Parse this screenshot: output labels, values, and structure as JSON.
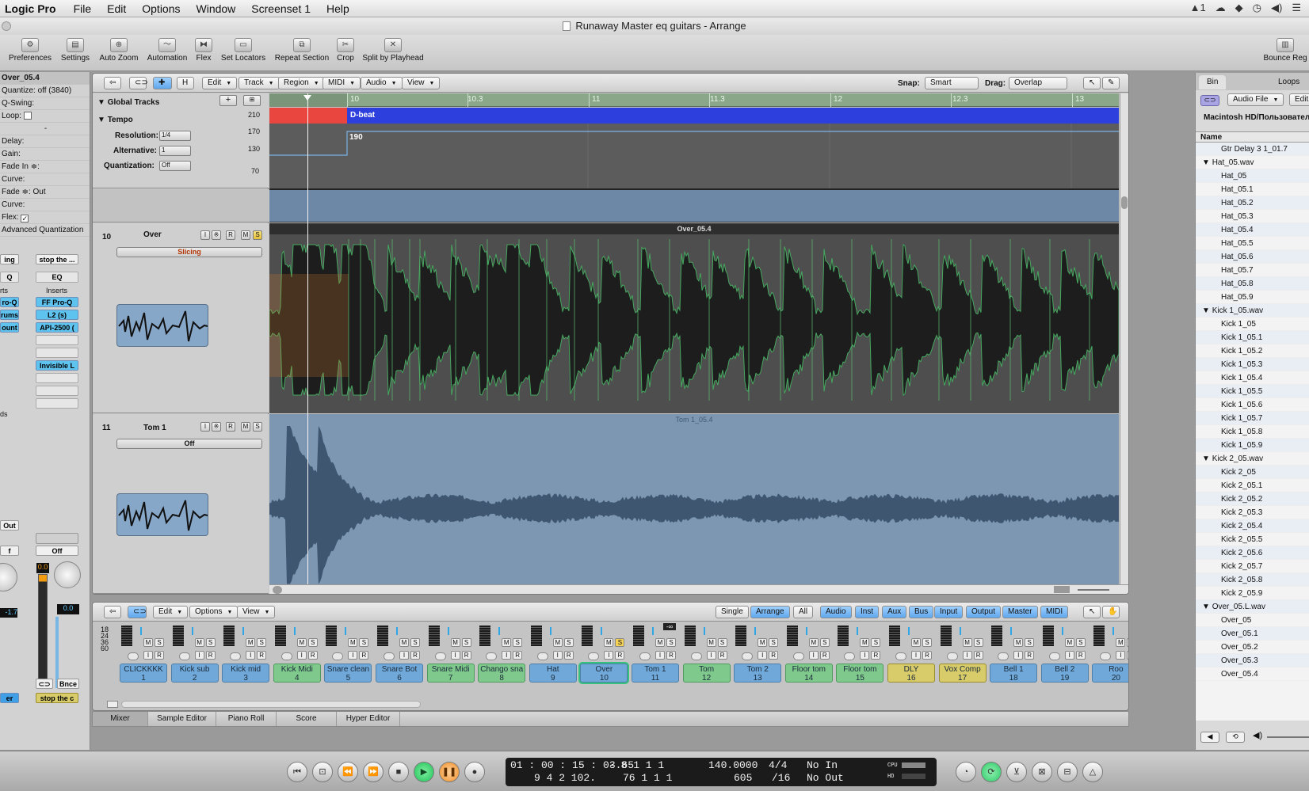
{
  "menubar": {
    "app": "Logic Pro",
    "items": [
      "File",
      "Edit",
      "Options",
      "Window",
      "Screenset 1",
      "Help"
    ],
    "status_text": "1"
  },
  "window": {
    "title": "Runaway Master eq guitars - Arrange"
  },
  "toolbar": {
    "items": [
      {
        "label": "Preferences",
        "icon": "preferences-icon"
      },
      {
        "label": "Settings",
        "icon": "settings-icon"
      },
      {
        "label": "Auto Zoom",
        "icon": "zoom-icon"
      },
      {
        "label": "Automation",
        "icon": "automation-icon"
      },
      {
        "label": "Flex",
        "icon": "flex-icon"
      },
      {
        "label": "Set Locators",
        "icon": "locators-icon"
      },
      {
        "label": "Repeat Section",
        "icon": "repeat-icon"
      },
      {
        "label": "Crop",
        "icon": "crop-icon"
      },
      {
        "label": "Split by Playhead",
        "icon": "split-icon"
      }
    ],
    "right_label": "Bounce Reg"
  },
  "inspector": {
    "region_name": "Over_05.4",
    "quantize": "Quantize: off (3840)",
    "swing": "Q-Swing:",
    "loop": "Loop:",
    "dash": "-",
    "delay": "Delay:",
    "gain": "Gain:",
    "fade_in": "Fade In ≑:",
    "curve1": "Curve:",
    "fade_out": "Fade ≑: Out",
    "curve2": "Curve:",
    "flex": "Flex:",
    "adv_quant": "Advanced Quantization",
    "strip_a": {
      "label": "ing",
      "eq": "Q",
      "inserts": "rts",
      "plugins": [
        "ro-Q",
        "rums",
        "ount"
      ],
      "sends": "ds",
      "out": "Out",
      "auto": "f",
      "vol": "-1.7",
      "name": "er"
    },
    "strip_b": {
      "label": "stop the ...",
      "eq": "EQ",
      "inserts": "Inserts",
      "plugins": [
        "FF Pro-Q",
        "L2 (s)",
        "API-2500 ("
      ],
      "invisible": "Invisible L",
      "auto": "Off",
      "vol": "0.0",
      "peak": "0.0",
      "bounce": "Bnce",
      "name": "stop the c"
    }
  },
  "arrange_bar": {
    "edit": "Edit",
    "track": "Track",
    "region": "Region",
    "midi": "MIDI",
    "audio": "Audio",
    "view": "View",
    "snap_label": "Snap:",
    "snap_value": "Smart",
    "drag_label": "Drag:",
    "drag_value": "Overlap"
  },
  "global_tracks": {
    "title": "Global Tracks",
    "tempo": "Tempo",
    "resolution_label": "Resolution:",
    "resolution_value": "1/4",
    "alternative_label": "Alternative:",
    "alternative_value": "1",
    "quantization_label": "Quantization:",
    "quantization_value": "Off",
    "scale": [
      "210",
      "170",
      "130",
      "70"
    ],
    "arrangement_marker": "D-beat",
    "tempo_value": "190"
  },
  "ruler": {
    "ticks": [
      "10",
      "10.3",
      "11",
      "11.3",
      "12",
      "12.3",
      "13"
    ]
  },
  "tracks": [
    {
      "number": "10",
      "name": "Over",
      "mode": "Slicing",
      "region": "Over_05.4"
    },
    {
      "number": "11",
      "name": "Tom 1",
      "mode": "Off",
      "region": "Tom 1_05.4"
    }
  ],
  "mixer": {
    "edit": "Edit",
    "options": "Options",
    "view": "View",
    "views": [
      "Single",
      "Arrange",
      "All"
    ],
    "filters": [
      "Audio",
      "Inst",
      "Aux",
      "Bus",
      "Input",
      "Output",
      "Master",
      "MIDI"
    ],
    "scale": [
      "18",
      "24",
      "36",
      "60"
    ],
    "strips": [
      {
        "name": "CLICKKKK",
        "num": "1",
        "color": "blue"
      },
      {
        "name": "Kick sub",
        "num": "2",
        "color": "blue"
      },
      {
        "name": "Kick mid",
        "num": "3",
        "color": "blue"
      },
      {
        "name": "Kick Midi",
        "num": "4",
        "color": "green"
      },
      {
        "name": "Snare clean",
        "num": "5",
        "color": "blue"
      },
      {
        "name": "Snare Bot",
        "num": "6",
        "color": "blue"
      },
      {
        "name": "Snare Midi",
        "num": "7",
        "color": "green"
      },
      {
        "name": "Chango sna",
        "num": "8",
        "color": "green"
      },
      {
        "name": "Hat",
        "num": "9",
        "color": "blue"
      },
      {
        "name": "Over",
        "num": "10",
        "color": "blue",
        "selected": true
      },
      {
        "name": "Tom 1",
        "num": "11",
        "color": "blue"
      },
      {
        "name": "Tom",
        "num": "12",
        "color": "green"
      },
      {
        "name": "Tom 2",
        "num": "13",
        "color": "blue"
      },
      {
        "name": "Floor tom",
        "num": "14",
        "color": "green"
      },
      {
        "name": "Floor tom",
        "num": "15",
        "color": "green"
      },
      {
        "name": "DLY",
        "num": "16",
        "color": "yellow"
      },
      {
        "name": "Vox Comp",
        "num": "17",
        "color": "yellow"
      },
      {
        "name": "Bell 1",
        "num": "18",
        "color": "blue"
      },
      {
        "name": "Bell 2",
        "num": "19",
        "color": "blue"
      },
      {
        "name": "Roo",
        "num": "20",
        "color": "blue"
      }
    ],
    "meter_readout": "-∞"
  },
  "bottom_tabs": [
    "Mixer",
    "Sample Editor",
    "Piano Roll",
    "Score",
    "Hyper Editor"
  ],
  "transport": {
    "smpte": "01 : 00 : 15 : 03.65",
    "bars": "9   4   2  102.",
    "pos_top": "-    8    1    1     1",
    "pos_bot": "76    1    1     1",
    "tempo": "140.0000",
    "tempo_sub": "605",
    "sig": "4/4",
    "div": "/16",
    "in": "No In",
    "out": "No Out",
    "cpu": "CPU",
    "hd": "HD"
  },
  "browser": {
    "tabs": [
      "Bin",
      "Loops"
    ],
    "audio_file": "Audio File",
    "edit": "Edit",
    "path": "Macintosh HD/Пользовател",
    "column": "Name",
    "items": [
      {
        "t": "child",
        "name": "Gtr Delay 3 1_01.7"
      },
      {
        "t": "head",
        "name": "Hat_05.wav"
      },
      {
        "t": "child",
        "name": "Hat_05"
      },
      {
        "t": "child",
        "name": "Hat_05.1"
      },
      {
        "t": "child",
        "name": "Hat_05.2"
      },
      {
        "t": "child",
        "name": "Hat_05.3"
      },
      {
        "t": "child",
        "name": "Hat_05.4"
      },
      {
        "t": "child",
        "name": "Hat_05.5"
      },
      {
        "t": "child",
        "name": "Hat_05.6"
      },
      {
        "t": "child",
        "name": "Hat_05.7"
      },
      {
        "t": "child",
        "name": "Hat_05.8"
      },
      {
        "t": "child",
        "name": "Hat_05.9"
      },
      {
        "t": "head",
        "name": "Kick 1_05.wav"
      },
      {
        "t": "child",
        "name": "Kick 1_05"
      },
      {
        "t": "child",
        "name": "Kick 1_05.1"
      },
      {
        "t": "child",
        "name": "Kick 1_05.2"
      },
      {
        "t": "child",
        "name": "Kick 1_05.3"
      },
      {
        "t": "child",
        "name": "Kick 1_05.4"
      },
      {
        "t": "child",
        "name": "Kick 1_05.5"
      },
      {
        "t": "child",
        "name": "Kick 1_05.6"
      },
      {
        "t": "child",
        "name": "Kick 1_05.7"
      },
      {
        "t": "child",
        "name": "Kick 1_05.8"
      },
      {
        "t": "child",
        "name": "Kick 1_05.9"
      },
      {
        "t": "head",
        "name": "Kick 2_05.wav"
      },
      {
        "t": "child",
        "name": "Kick 2_05"
      },
      {
        "t": "child",
        "name": "Kick 2_05.1"
      },
      {
        "t": "child",
        "name": "Kick 2_05.2"
      },
      {
        "t": "child",
        "name": "Kick 2_05.3"
      },
      {
        "t": "child",
        "name": "Kick 2_05.4"
      },
      {
        "t": "child",
        "name": "Kick 2_05.5"
      },
      {
        "t": "child",
        "name": "Kick 2_05.6"
      },
      {
        "t": "child",
        "name": "Kick 2_05.7"
      },
      {
        "t": "child",
        "name": "Kick 2_05.8"
      },
      {
        "t": "child",
        "name": "Kick 2_05.9"
      },
      {
        "t": "head",
        "name": "Over_05.L.wav"
      },
      {
        "t": "child",
        "name": "Over_05"
      },
      {
        "t": "child",
        "name": "Over_05.1"
      },
      {
        "t": "child",
        "name": "Over_05.2"
      },
      {
        "t": "child",
        "name": "Over_05.3"
      },
      {
        "t": "child",
        "name": "Over_05.4"
      }
    ]
  }
}
